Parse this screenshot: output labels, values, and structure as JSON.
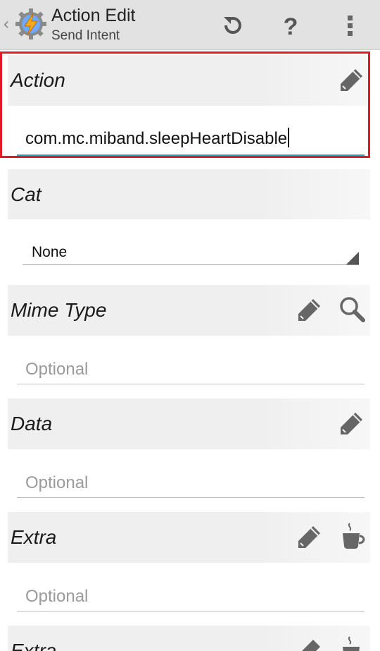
{
  "app_bar": {
    "title": "Action Edit",
    "subtitle": "Send Intent",
    "back_glyph": "‹",
    "icons": [
      "tasker-app-icon",
      "refresh-icon",
      "help-icon",
      "overflow-menu-icon"
    ]
  },
  "sections": {
    "action": {
      "label": "Action",
      "value": "com.mc.miband.sleepHeartDisable"
    },
    "cat": {
      "label": "Cat",
      "selected": "None"
    },
    "mime_type": {
      "label": "Mime Type",
      "placeholder": "Optional"
    },
    "data": {
      "label": "Data",
      "placeholder": "Optional"
    },
    "extra": {
      "label": "Extra",
      "placeholder": "Optional"
    },
    "extra2": {
      "label": "Extra"
    }
  },
  "colors": {
    "highlight_border": "#e01b24",
    "active_underline": "#2fa3c2",
    "appbar_bg": "#e2e2e2",
    "section_bg": "#efefef",
    "icon_gray": "#666666"
  }
}
